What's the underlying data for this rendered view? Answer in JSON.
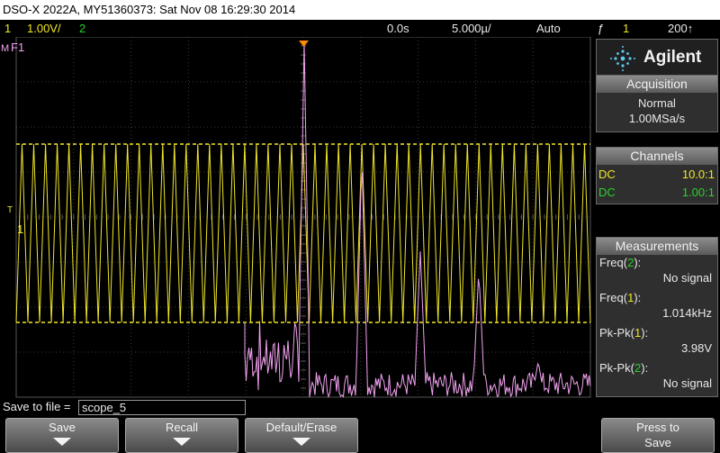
{
  "title_bar": {
    "text": "DSO-X 2022A, MY51360373: Sat Nov 08 16:29:30 2014"
  },
  "status": {
    "ch1_number": "1",
    "ch1_scale": "1.00V/",
    "ch2_number": "2",
    "trigger_delay": "0.0s",
    "time_scale": "5.000µ/",
    "trigger_mode": "Auto",
    "trigger_symbol": "ƒ",
    "trigger_source": "1",
    "trigger_level": "200↑"
  },
  "markers": {
    "math_label": "F1",
    "ch1_ground": "1",
    "trigger_mark": "T"
  },
  "brand": {
    "name": "Agilent"
  },
  "acquisition": {
    "header": "Acquisition",
    "mode": "Normal",
    "rate": "1.00MSa/s"
  },
  "channels": {
    "header": "Channels",
    "rows": [
      {
        "coupling": "DC",
        "probe": "10.0:1",
        "color": "#f0e628"
      },
      {
        "coupling": "DC",
        "probe": "1.00:1",
        "color": "#28d228"
      }
    ]
  },
  "measurements": {
    "header": "Measurements",
    "items": [
      {
        "name": "Freq",
        "channel": "2",
        "value": "No signal"
      },
      {
        "name": "Freq",
        "channel": "1",
        "value": "1.014kHz"
      },
      {
        "name": "Pk-Pk",
        "channel": "1",
        "value": "3.98V"
      },
      {
        "name": "Pk-Pk",
        "channel": "2",
        "value": "No signal"
      }
    ]
  },
  "save": {
    "label": "Save to file =",
    "filename": "scope_5"
  },
  "softkeys": [
    {
      "label": "Save",
      "label2": "",
      "arrow": true
    },
    {
      "label": "Recall",
      "label2": "",
      "arrow": true
    },
    {
      "label": "Default/Erase",
      "label2": "",
      "arrow": true
    },
    {
      "label": "Press to",
      "label2": "Save",
      "arrow": false
    }
  ],
  "colors": {
    "ch1": "#f0e628",
    "ch2": "#28d228",
    "math": "#f2a2f0",
    "trigger_marker": "#ff8a00",
    "background": "#000000"
  }
}
